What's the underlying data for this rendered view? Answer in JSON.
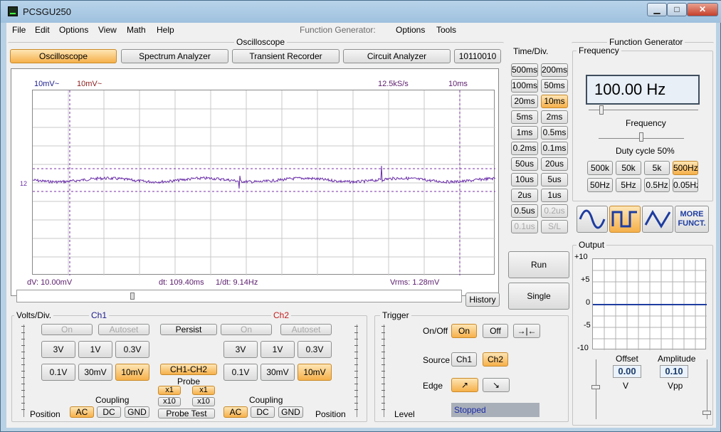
{
  "window": {
    "title": "PCSGU250",
    "min": "▁",
    "max": "□",
    "close": "✕"
  },
  "menu": [
    "File",
    "Edit",
    "Options",
    "View",
    "Math",
    "Help",
    "Function Generator:",
    "Options",
    "Tools"
  ],
  "scope_section": {
    "title": "Oscilloscope"
  },
  "tabs": [
    "Oscilloscope",
    "Spectrum Analyzer",
    "Transient Recorder",
    "Circuit Analyzer",
    "10110010"
  ],
  "plot": {
    "ch1_vdiv": "10mV~",
    "ch2_vdiv": "10mV~",
    "samplerate": "12.5kS/s",
    "timebase": "10ms",
    "marker": "12",
    "dv": "dV: 10.00mV",
    "dt": "dt: 109.40ms",
    "inv_dt": "1/dt: 9.14Hz",
    "vrms": "Vrms: 1.28mV",
    "trace_color": "#6a2ea8"
  },
  "history_label": "History",
  "timediv": {
    "title": "Time/Div.",
    "buttons": [
      "500ms",
      "200ms",
      "100ms",
      "50ms",
      "20ms",
      "10ms",
      "5ms",
      "2ms",
      "1ms",
      "0.5ms",
      "0.2ms",
      "0.1ms",
      "50us",
      "20us",
      "10us",
      "5us",
      "2us",
      "1us",
      "0.5us",
      "0.2us",
      "0.1us",
      "S/L"
    ],
    "selected": "10ms",
    "disabled": [
      "0.2us",
      "0.1us",
      "S/L"
    ]
  },
  "run_label": "Run",
  "single_label": "Single",
  "volts": {
    "title": "Volts/Div.",
    "ch1_title": "Ch1",
    "ch2_title": "Ch2",
    "on": "On",
    "autoset": "Autoset",
    "persist": "Persist",
    "ranges": [
      "3V",
      "1V",
      "0.3V",
      "0.1V",
      "30mV",
      "10mV"
    ],
    "selected": "10mV",
    "ch1ch2": "CH1-CH2",
    "probe": "Probe",
    "x1": "x1",
    "x10": "x10",
    "probe_test": "Probe Test",
    "coupling": "Coupling",
    "ac": "AC",
    "dc": "DC",
    "gnd": "GND",
    "position": "Position"
  },
  "trigger": {
    "title": "Trigger",
    "onoff": "On/Off",
    "on": "On",
    "off": "Off",
    "source": "Source",
    "ch1": "Ch1",
    "ch2": "Ch2",
    "edge": "Edge",
    "level": "Level",
    "status": "Stopped"
  },
  "fgen": {
    "title": "Function Generator",
    "frequency_group": "Frequency",
    "freq_value": "100.00 Hz",
    "freq_label": "Frequency",
    "duty_label": "Duty cycle 50%",
    "ranges": [
      "500k",
      "50k",
      "5k",
      "500Hz",
      "50Hz",
      "5Hz",
      "0.5Hz",
      "0.05Hz"
    ],
    "selected_range": "500Hz",
    "more": "MORE FUNCT.",
    "output_title": "Output",
    "y_ticks": [
      "+10",
      "+5",
      "0",
      "-5",
      "-10"
    ],
    "offset_label": "Offset",
    "offset_value": "0.00",
    "offset_unit": "V",
    "amp_label": "Amplitude",
    "amp_value": "0.10",
    "amp_unit": "Vpp",
    "accent": "#1e3ca0"
  }
}
